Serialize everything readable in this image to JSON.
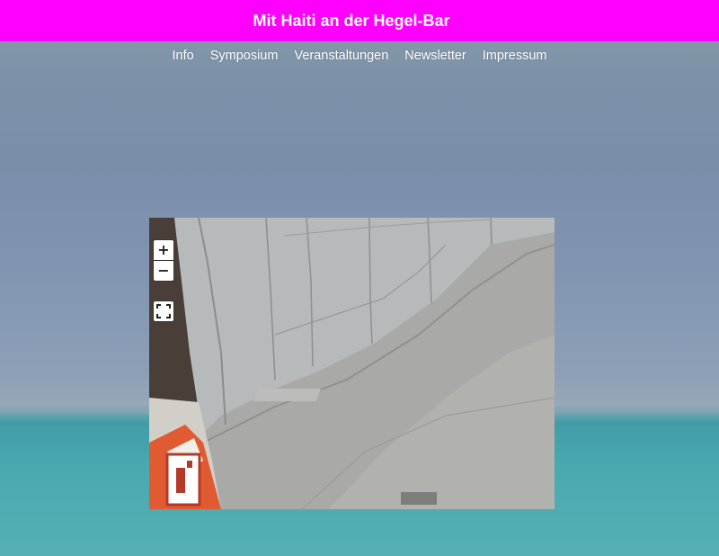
{
  "header": {
    "title": "Mit Haiti an der Hegel-Bar"
  },
  "nav": {
    "items": [
      {
        "label": "Info"
      },
      {
        "label": "Symposium"
      },
      {
        "label": "Veranstaltungen"
      },
      {
        "label": "Newsletter"
      },
      {
        "label": "Impressum"
      }
    ]
  },
  "viewer": {
    "controls": {
      "zoom_in": "+",
      "zoom_out": "−",
      "fullscreen_icon": "fullscreen-icon"
    }
  },
  "colors": {
    "header_bg": "#ff00ff",
    "header_text": "#ffffff",
    "nav_text": "#ffffff"
  }
}
